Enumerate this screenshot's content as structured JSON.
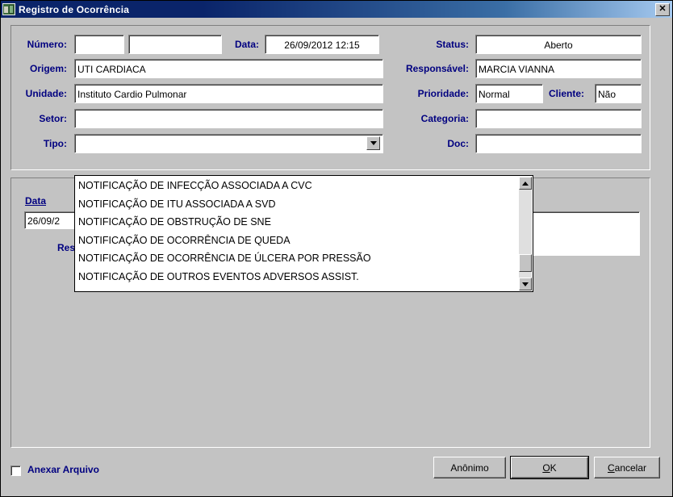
{
  "window": {
    "title": "Registro de Ocorrência",
    "icon": "app-icon",
    "close_label": "✕"
  },
  "form": {
    "numero_label": "Número:",
    "numero_value": "",
    "numero_value2": "",
    "data_label": "Data:",
    "data_value": "26/09/2012 12:15",
    "status_label": "Status:",
    "status_value": "Aberto",
    "origem_label": "Origem:",
    "origem_value": "UTI CARDIACA",
    "responsavel_label": "Responsável:",
    "responsavel_value": "MARCIA VIANNA",
    "unidade_label": "Unidade:",
    "unidade_value": "Instituto Cardio Pulmonar",
    "prioridade_label": "Prioridade:",
    "prioridade_value": "Normal",
    "cliente_label": "Cliente:",
    "cliente_value": "Não",
    "setor_label": "Setor:",
    "setor_value": "",
    "categoria_label": "Categoria:",
    "categoria_value": "",
    "tipo_label": "Tipo:",
    "tipo_value": "",
    "doc_label": "Doc:",
    "doc_value": ""
  },
  "dropdown": {
    "open": true,
    "items": [
      "NOTIFICAÇÃO DE INFECÇÃO ASSOCIADA A CVC",
      "NOTIFICAÇÃO DE ITU ASSOCIADA A SVD",
      "NOTIFICAÇÃO DE OBSTRUÇÃO DE SNE",
      "NOTIFICAÇÃO DE OCORRÊNCIA DE QUEDA",
      "NOTIFICAÇÃO DE OCORRÊNCIA DE ÚLCERA POR PRESSÃO",
      "NOTIFICAÇÃO DE OUTROS EVENTOS ADVERSOS ASSIST."
    ],
    "scroll_up_icon": "scroll-up-arrow-icon",
    "scroll_down_icon": "scroll-down-arrow-icon"
  },
  "detail_group": {
    "data_header": "Data",
    "data_value": "26/09/2",
    "resposta_label": "Res",
    "resposta_value": ""
  },
  "footer": {
    "anexar_label": "Anexar Arquivo",
    "anexar_checked": false,
    "anonimo_label": "Anônimo",
    "ok_label_underline": "O",
    "ok_label_rest": "K",
    "cancelar_label_underline": "C",
    "cancelar_label_rest": "ancelar"
  },
  "colors": {
    "title_start": "#0a246a",
    "title_end": "#a6caf0",
    "label_navy": "#000080",
    "face": "#c3c3c3",
    "field_bg": "#ffffff"
  }
}
